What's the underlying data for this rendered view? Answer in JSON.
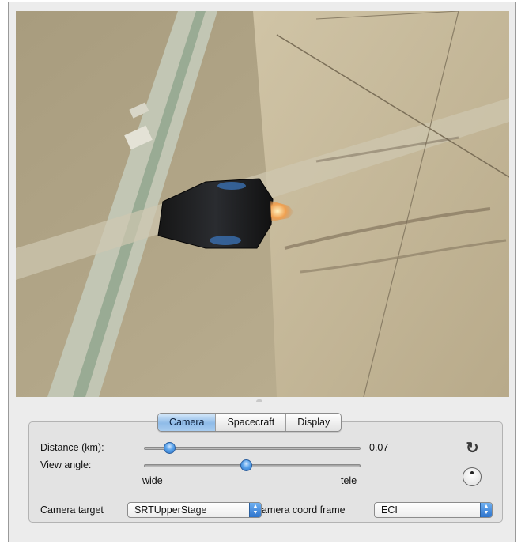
{
  "tabs": [
    {
      "label": "Camera",
      "active": true
    },
    {
      "label": "Spacecraft",
      "active": false
    },
    {
      "label": "Display",
      "active": false
    }
  ],
  "camera": {
    "distance_label": "Distance (km):",
    "distance_value": "0.07",
    "view_angle_label": "View angle:",
    "wide_label": "wide",
    "tele_label": "tele",
    "target_label": "Camera target",
    "target_value": "SRTUpperStage",
    "coord_frame_label": "amera coord frame",
    "coord_frame_value": "ECI"
  },
  "controls": {
    "reset_icon": "reset-rotation-icon",
    "dial_icon": "orientation-dial-icon"
  },
  "accent_color": "#3b8ae0"
}
